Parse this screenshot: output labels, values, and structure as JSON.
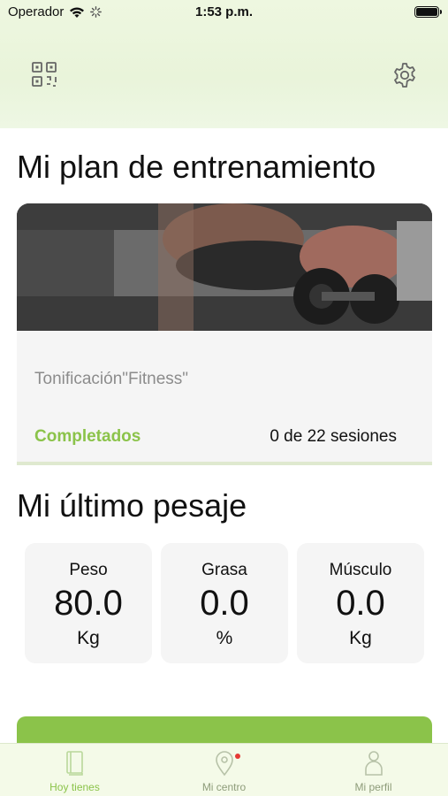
{
  "status_bar": {
    "carrier": "Operador",
    "time": "1:53 p.m."
  },
  "header": {
    "qr_icon": "qr-code-icon",
    "settings_icon": "gear-icon"
  },
  "plan_section": {
    "title": "Mi plan de entrenamiento",
    "plan_name": "Tonificación\"Fitness\"",
    "completed_label": "Completados",
    "sessions_value": "0 de 22 sesiones"
  },
  "weigh_section": {
    "title": "Mi último pesaje",
    "metrics": [
      {
        "label": "Peso",
        "value": "80.0",
        "unit": "Kg"
      },
      {
        "label": "Grasa",
        "value": "0.0",
        "unit": "%"
      },
      {
        "label": "Músculo",
        "value": "0.0",
        "unit": "Kg"
      }
    ]
  },
  "tab_bar": {
    "items": [
      {
        "label": "Hoy tienes",
        "icon": "book-icon",
        "active": true
      },
      {
        "label": "Mi centro",
        "icon": "location-pin-icon",
        "badge": true
      },
      {
        "label": "Mi perfil",
        "icon": "person-icon"
      }
    ]
  },
  "colors": {
    "accent": "#8bc34a",
    "header_bg": "#eef7e0",
    "card_bg": "#f5f5f5",
    "tab_inactive": "#8e9c7a",
    "badge": "#e53935"
  }
}
